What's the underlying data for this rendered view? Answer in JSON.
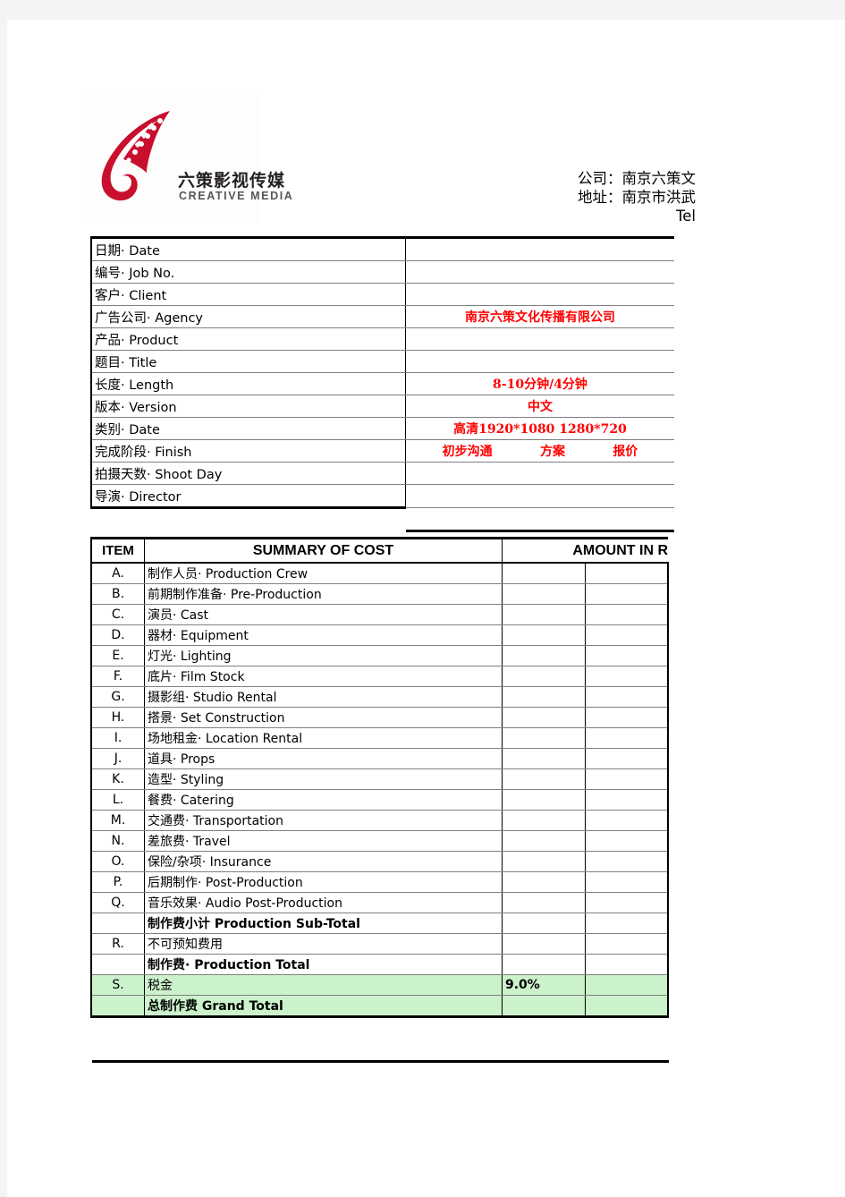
{
  "logo": {
    "cn_name": "六策影视传媒",
    "en_name": "CREATIVE MEDIA",
    "brand_color": "#c8102e"
  },
  "header": {
    "lines": [
      "公司：南京六策文",
      "地址：南京市洪武",
      "Tel"
    ]
  },
  "info_table": {
    "rows": [
      {
        "label": "日期· Date",
        "value": ""
      },
      {
        "label": "编号· Job No.",
        "value": ""
      },
      {
        "label": "客户· Client",
        "value": ""
      },
      {
        "label": "广告公司· Agency",
        "value": "南京六策文化传播有限公司"
      },
      {
        "label": "产品· Product",
        "value": ""
      },
      {
        "label": "题目· Title",
        "value": ""
      },
      {
        "label": "长度· Length",
        "value": "8-10分钟/4分钟"
      },
      {
        "label": "版本· Version",
        "value": "中文"
      },
      {
        "label": "类别· Date",
        "value": "高清1920*1080  1280*720"
      },
      {
        "label": "完成阶段· Finish",
        "value": ""
      },
      {
        "label": "拍摄天数· Shoot Day",
        "value": ""
      },
      {
        "label": "导演· Director",
        "value": ""
      }
    ],
    "finish_stages": [
      "初步沟通",
      "方案",
      "报价"
    ],
    "value_color": "#ff0000"
  },
  "cost_table": {
    "headers": {
      "item": "ITEM",
      "summary": "SUMMARY OF COST",
      "amount": "AMOUNT IN R"
    },
    "rows": [
      {
        "item": "A.",
        "desc": "制作人员· Production Crew",
        "mid": "",
        "amount": "",
        "bold": false,
        "green": false
      },
      {
        "item": "B.",
        "desc": "前期制作准备· Pre-Production",
        "mid": "",
        "amount": "",
        "bold": false,
        "green": false
      },
      {
        "item": "C.",
        "desc": "演员· Cast",
        "mid": "",
        "amount": "",
        "bold": false,
        "green": false
      },
      {
        "item": "D.",
        "desc": "器材· Equipment",
        "mid": "",
        "amount": "",
        "bold": false,
        "green": false
      },
      {
        "item": "E.",
        "desc": "灯光· Lighting",
        "mid": "",
        "amount": "",
        "bold": false,
        "green": false
      },
      {
        "item": "F.",
        "desc": "底片· Film Stock",
        "mid": "",
        "amount": "",
        "bold": false,
        "green": false
      },
      {
        "item": "G.",
        "desc": "摄影组· Studio Rental",
        "mid": "",
        "amount": "",
        "bold": false,
        "green": false
      },
      {
        "item": "H.",
        "desc": "搭景· Set Construction",
        "mid": "",
        "amount": "",
        "bold": false,
        "green": false
      },
      {
        "item": "I.",
        "desc": "场地租金· Location Rental",
        "mid": "",
        "amount": "",
        "bold": false,
        "green": false
      },
      {
        "item": "J.",
        "desc": "道具· Props",
        "mid": "",
        "amount": "",
        "bold": false,
        "green": false
      },
      {
        "item": "K.",
        "desc": "造型· Styling",
        "mid": "",
        "amount": "",
        "bold": false,
        "green": false
      },
      {
        "item": "L.",
        "desc": "餐费· Catering",
        "mid": "",
        "amount": "",
        "bold": false,
        "green": false
      },
      {
        "item": "M.",
        "desc": "交通费· Transportation",
        "mid": "",
        "amount": "",
        "bold": false,
        "green": false
      },
      {
        "item": "N.",
        "desc": "差旅费· Travel",
        "mid": "",
        "amount": "",
        "bold": false,
        "green": false
      },
      {
        "item": "O.",
        "desc": "保险/杂项· Insurance",
        "mid": "",
        "amount": "",
        "bold": false,
        "green": false
      },
      {
        "item": "P.",
        "desc": "后期制作· Post-Production",
        "mid": "",
        "amount": "",
        "bold": false,
        "green": false
      },
      {
        "item": "Q.",
        "desc": "音乐效果· Audio Post-Production",
        "mid": "",
        "amount": "",
        "bold": false,
        "green": false
      },
      {
        "item": "",
        "desc": "制作费小计 Production Sub-Total",
        "mid": "",
        "amount": "",
        "bold": true,
        "green": false
      },
      {
        "item": "R.",
        "desc": "不可预知费用",
        "mid": "",
        "amount": "",
        "bold": false,
        "green": false
      },
      {
        "item": "",
        "desc": "制作费· Production Total",
        "mid": "",
        "amount": "",
        "bold": true,
        "green": false
      },
      {
        "item": "S.",
        "desc": "税金",
        "mid": "9.0%",
        "amount": "",
        "bold": false,
        "green": true
      },
      {
        "item": "",
        "desc": "总制作费 Grand Total",
        "mid": "",
        "amount": "",
        "bold": true,
        "green": true
      }
    ],
    "highlight_color": "#ccf2cc"
  }
}
